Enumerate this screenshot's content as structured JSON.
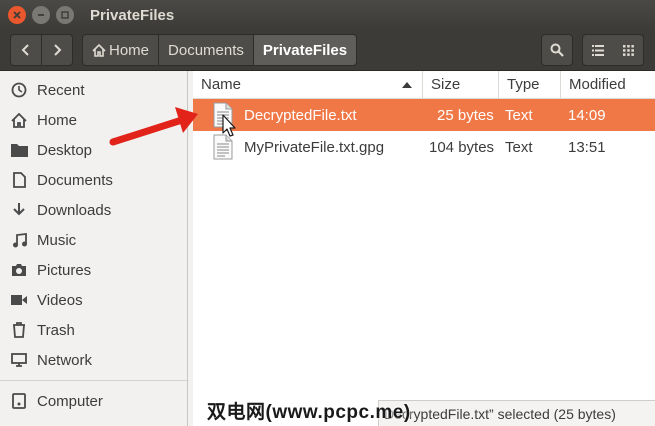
{
  "window": {
    "title": "PrivateFiles"
  },
  "breadcrumbs": [
    "Home",
    "Documents",
    "PrivateFiles"
  ],
  "sidebar": {
    "items": [
      {
        "label": "Recent",
        "icon": "clock-icon"
      },
      {
        "label": "Home",
        "icon": "home-icon"
      },
      {
        "label": "Desktop",
        "icon": "folder-icon"
      },
      {
        "label": "Documents",
        "icon": "document-icon"
      },
      {
        "label": "Downloads",
        "icon": "download-icon"
      },
      {
        "label": "Music",
        "icon": "music-icon"
      },
      {
        "label": "Pictures",
        "icon": "camera-icon"
      },
      {
        "label": "Videos",
        "icon": "video-icon"
      },
      {
        "label": "Trash",
        "icon": "trash-icon"
      },
      {
        "label": "Network",
        "icon": "network-icon"
      }
    ],
    "devices": [
      {
        "label": "Computer",
        "icon": "drive-icon"
      }
    ]
  },
  "columns": {
    "name": "Name",
    "size": "Size",
    "type": "Type",
    "modified": "Modified"
  },
  "files": [
    {
      "name": "DecryptedFile.txt",
      "size": "25 bytes",
      "type": "Text",
      "modified": "14:09",
      "selected": true
    },
    {
      "name": "MyPrivateFile.txt.gpg",
      "size": "104 bytes",
      "type": "Text",
      "modified": "13:51",
      "selected": false
    }
  ],
  "status": {
    "text": "DecryptedFile.txt” selected  (25 bytes)"
  },
  "watermark": {
    "text": "双电网(www.pcpc.me)"
  },
  "colors": {
    "selection": "#f07746",
    "close_button": "#e9582d",
    "annotation_arrow": "#e2231a"
  }
}
